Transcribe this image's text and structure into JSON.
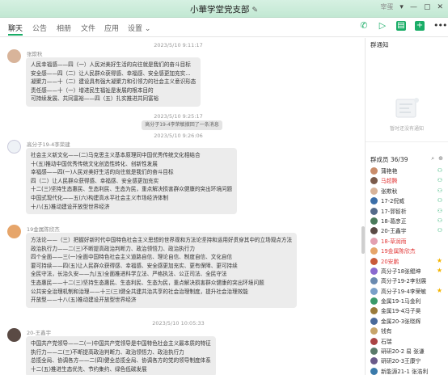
{
  "window": {
    "title": "小華学堂党支部",
    "account_label": "宰蛋",
    "controls": [
      "▾",
      "—",
      "▢",
      "✕"
    ]
  },
  "tabs": [
    {
      "label": "聊天",
      "active": true
    },
    {
      "label": "公告",
      "active": false
    },
    {
      "label": "相册",
      "active": false
    },
    {
      "label": "文件",
      "active": false
    },
    {
      "label": "应用",
      "active": false
    },
    {
      "label": "设置 ⌄",
      "active": false
    }
  ],
  "toolbar_icons": [
    "phone-icon",
    "video-icon",
    "image-icon",
    "add-icon",
    "more-icon"
  ],
  "colors": {
    "accent": "#1aad67",
    "bubble": "#ececec",
    "title_bar": "#c9ecd8",
    "admin_red": "#e23b3b"
  },
  "chat": {
    "timestamps": [
      "2023/5/10 9:11:17",
      "2023/5/10 9:25:17",
      "2023/5/10 9:26:06",
      "2023/5/10 10:05:33"
    ],
    "system_message": "高分子19-4李荣敏撤回了一条消息",
    "messages": [
      {
        "sender": "张欺秋",
        "avatar_color": "#d8b49a",
        "lines": [
          "人民幸福感——四（一）人民对美好生活的向往就是我们的奋斗目标",
          "安全感——四（二）让人民群众获得感、幸福感、安全感更加充实...",
          "凝聚力——十（二）建设具有强大凝聚力和引领力的社会主义意识形态",
          "责任感——十（一）增进民生福祉是发展的根本目的",
          "可持续发展、共同富裕——四（五）扎实推进共同富裕"
        ]
      },
      {
        "sender": "高分子19-4李荣建",
        "avatar_color": "#7aa0c9",
        "lines": [
          "社会主义新文化——(二)马克思主义基本原理同中国优秀传统文化相结合",
          "十(五)推动中国优秀传统文化创造性转化、创新性发展",
          "幸福感——四(一)人民对美好生活的向往就是我们的奋斗目标",
          "四（二）让人民群众获得感、幸福感、安全感更加充实",
          "十二(三)坚持生态惠民、生态利民、生态为民，重点解决损害群众健康的突出环境问题",
          "中国式现代化——五(六)构建高水平社会主义市场经济体制",
          "十八(五)推动建设开放型世界经济"
        ]
      },
      {
        "sender": "19金属陈欣杰",
        "avatar_color": "#e6a56a",
        "lines": [
          "方法论——（三）把握好新时代中国特色社会主义思想的世界观和方法论坚持和运用好贯穿其中的立场观点方法",
          "政治执行力——二(三)不断提高政治判断力、政治领悟力、政治执行力",
          "四个全面——三(一)全面中国特色社会主义道路自信、理论自信、制度自信、文化自信",
          "要可持续——四(五)让人民群众获得感、幸福感、安全感更加充实、更有保障、更可持续",
          "全民守法，长治久安——九(五)全面推进科学立法、严格执法、公正司法、全民守法",
          "生态惠民——十二(三)坚持生态惠民、生态利民、生态为民，重点解决损害群众健康的突出环境问题",
          "公共安全治理机制和治理——十三(三)健全共建共治共享的社会治理制度，提升社会治理效能",
          "开放型——十八(五)推动建设开放型世界经济"
        ]
      },
      {
        "sender": "20-王鑫宇",
        "avatar_color": "#5a4a44",
        "lines": [
          "中国共产党领导——二(一)中国共产党领导是中国特色社会主义最本质的特征",
          "执行力——二(三)不断提高政治判断力、政治领悟力、政治执行力",
          "总揽全局、协调各方——二(四)健全总揽全局、协调各方的党的领导制度体系",
          "十二(五)推进生态优先、节约集约、绿色低碳发展"
        ]
      }
    ]
  },
  "sidebar": {
    "notice_title": "群通知",
    "notice_empty": "暂时还没有通知",
    "members_title": "群成员 36/39",
    "members": [
      {
        "name": "蒲艳艳",
        "role": "person",
        "highlight": false,
        "color": "#c98c6a"
      },
      {
        "name": "马超腾",
        "role": "person",
        "highlight": true,
        "color": "#7a5a4a"
      },
      {
        "name": "张欺秋",
        "role": "person",
        "highlight": false,
        "color": "#d8b49a"
      },
      {
        "name": "17-2倪威",
        "role": "person",
        "highlight": false,
        "color": "#3b6ea8"
      },
      {
        "name": "17-郭智析",
        "role": "person",
        "highlight": false,
        "color": "#556b8a"
      },
      {
        "name": "18-葛彦正",
        "role": "person",
        "highlight": false,
        "color": "#4a7a5a"
      },
      {
        "name": "20-王鑫宇",
        "role": "person",
        "highlight": false,
        "color": "#5a4a44"
      },
      {
        "name": "18-草润雨",
        "role": "none",
        "highlight": true,
        "color": "#e3a0b0"
      },
      {
        "name": "19金属陈欣杰",
        "role": "none",
        "highlight": true,
        "color": "#e6a56a"
      },
      {
        "name": "20安鹏",
        "role": "star",
        "highlight": true,
        "color": "#c95a3a"
      },
      {
        "name": "高分子18张鲲坤",
        "role": "star",
        "highlight": false,
        "color": "#8a6ad0"
      },
      {
        "name": "高分子19-2李划展",
        "role": "none",
        "highlight": false,
        "color": "#6a8ab0"
      },
      {
        "name": "高分子19-4李荣敏",
        "role": "star",
        "highlight": false,
        "color": "#7aa0c9"
      },
      {
        "name": "金属19-1马金利",
        "role": "none",
        "highlight": false,
        "color": "#3a9a6a"
      },
      {
        "name": "金属19-4冯子昊",
        "role": "none",
        "highlight": false,
        "color": "#9a7a3a"
      },
      {
        "name": "金属20-3张晓辉",
        "role": "none",
        "highlight": false,
        "color": "#4a6a9a"
      },
      {
        "name": "钱有",
        "role": "none",
        "highlight": false,
        "color": "#c7a46a"
      },
      {
        "name": "石瑞",
        "role": "none",
        "highlight": false,
        "color": "#aa4444"
      },
      {
        "name": "研研20-2 易 张谦",
        "role": "none",
        "highlight": false,
        "color": "#5a7a6a"
      },
      {
        "name": "研研20-3王康宁",
        "role": "none",
        "highlight": false,
        "color": "#6a5a8a"
      },
      {
        "name": "新能源21-1 张浩利",
        "role": "none",
        "highlight": false,
        "color": "#3a7aaa"
      }
    ]
  }
}
